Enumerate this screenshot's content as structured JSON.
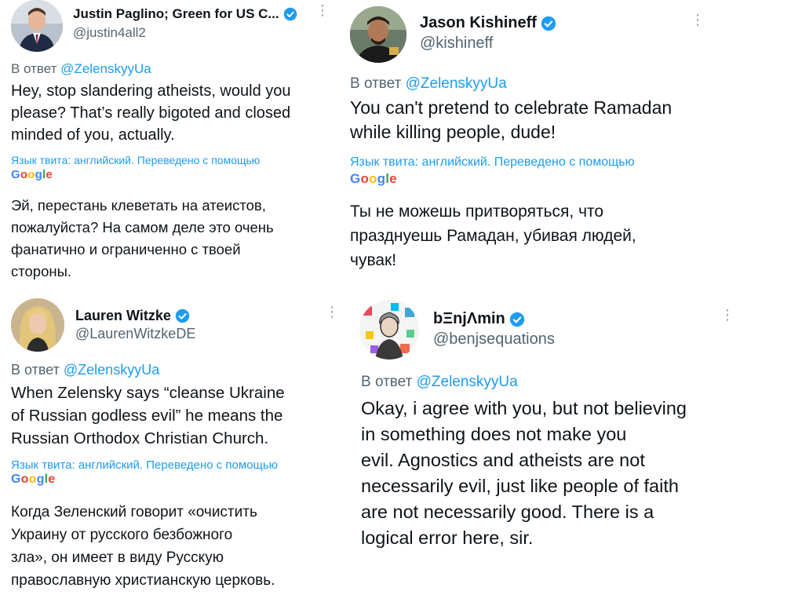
{
  "tweets": [
    {
      "name": "Justin Paglino; Green for US C...",
      "handle": "@justin4all2",
      "reply_prefix": "В ответ ",
      "reply_to": "@ZelenskyyUa",
      "text": "Hey, stop slandering atheists, would you\nplease? That’s really bigoted and closed\nminded of you, actually.",
      "translation_note": "Язык твита: английский. Переведено с помощью",
      "translation_brand": "Google",
      "translation": "Эй, перестань клеветать на атеистов,\nпожалуйста? На самом деле это очень\nфанатично и ограниченно с твоей\nстороны.",
      "menu_icon": "more-vertical-icon",
      "verified_color": "#1d9bf0"
    },
    {
      "name": "Jason Kishineff",
      "handle": "@kishineff",
      "reply_prefix": "В ответ ",
      "reply_to": "@ZelenskyyUa",
      "text": "You can't pretend to celebrate Ramadan\nwhile killing people, dude!",
      "translation_note": "Язык твита: английский. Переведено с помощью",
      "translation_brand": "Google",
      "translation": "Ты не можешь притворяться, что\nпразднуешь Рамадан, убивая людей,\nчувак!",
      "menu_icon": "more-vertical-icon",
      "verified_color": "#1d9bf0"
    },
    {
      "name": "Lauren Witzke",
      "handle": "@LaurenWitzkeDE",
      "reply_prefix": "В ответ ",
      "reply_to": "@ZelenskyyUa",
      "text": "When Zelensky says “cleanse Ukraine\nof Russian godless evil” he means the\nRussian Orthodox Christian Church.",
      "translation_note": "Язык твита: английский. Переведено с помощью",
      "translation_brand": "Google",
      "translation": "Когда Зеленский говорит «очистить\nУкраину от русского безбожного\nзла», он имеет в виду Русскую\nправославную христианскую церковь.",
      "menu_icon": "more-vertical-icon",
      "verified_color": "#1d9bf0"
    },
    {
      "name": "bΞnjΛmin",
      "handle": "@benjsequations",
      "reply_prefix": "В ответ ",
      "reply_to": "@ZelenskyyUa",
      "text": "Okay, i agree with you, but not believing\nin something does not make you\nevil. Agnostics and atheists are not\nnecessarily evil, just like people of faith\nare not necessarily good. There is a\nlogical error here, sir.",
      "menu_icon": "more-vertical-icon",
      "verified_color": "#1d9bf0"
    }
  ]
}
